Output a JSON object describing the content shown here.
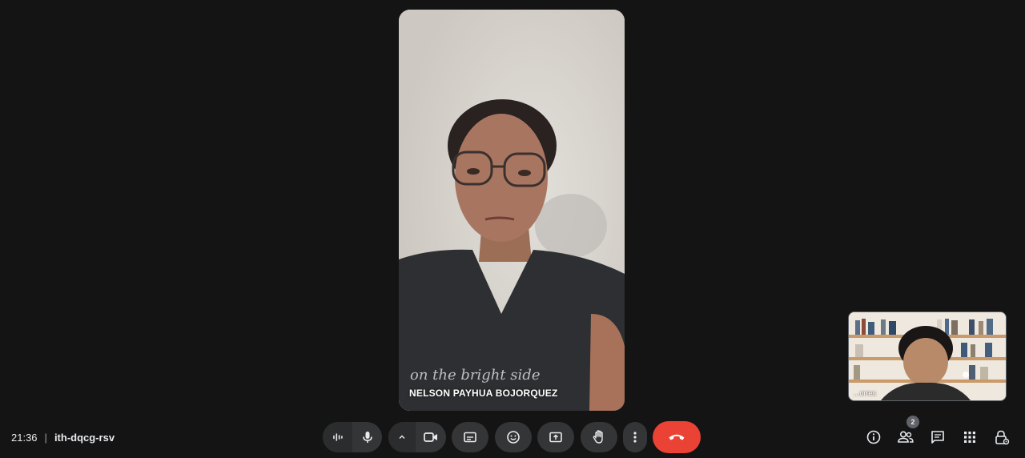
{
  "main_participant": {
    "name": "NELSON PAYHUA BOJORQUEZ",
    "shirt_text": "on the bright side"
  },
  "self_view": {
    "name": "...orres"
  },
  "meeting": {
    "time": "21:36",
    "separator": "|",
    "code": "ith-dqcg-rsv"
  },
  "controls": [
    {
      "icon": "audio-wave-icon"
    },
    {
      "icon": "microphone-icon"
    },
    {
      "icon": "chevron-up-icon"
    },
    {
      "icon": "camera-icon"
    },
    {
      "icon": "captions-icon"
    },
    {
      "icon": "emoji-icon"
    },
    {
      "icon": "present-screen-icon"
    },
    {
      "icon": "raise-hand-icon"
    },
    {
      "icon": "more-options-icon"
    },
    {
      "icon": "end-call-icon"
    }
  ],
  "right_panel": {
    "participants_count": "2",
    "icons": [
      "info-icon",
      "people-icon",
      "chat-icon",
      "activities-icon",
      "host-controls-icon"
    ]
  },
  "colors": {
    "background": "#131313",
    "control_bg": "#333537",
    "end_call": "#ea4335",
    "text": "#e8eaed"
  }
}
